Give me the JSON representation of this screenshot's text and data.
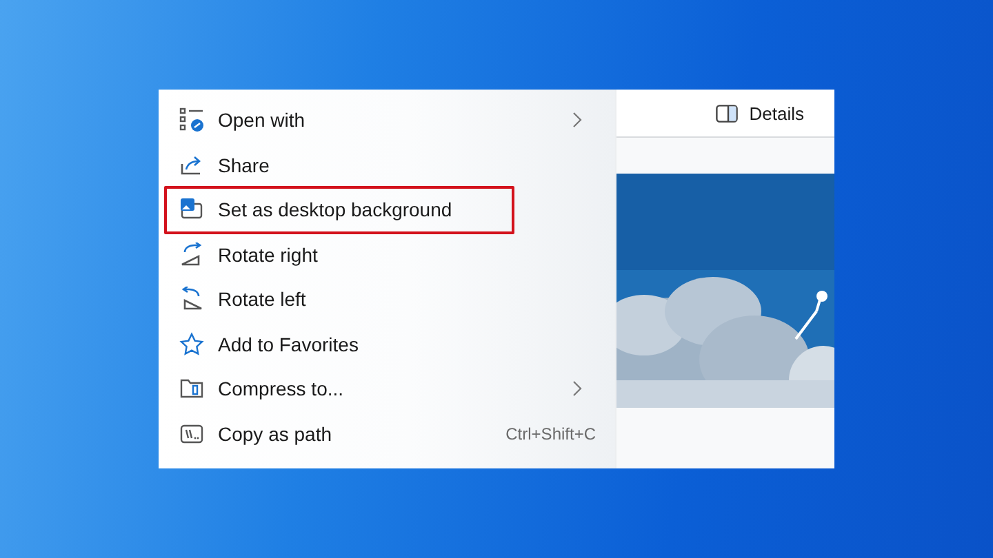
{
  "menu": {
    "items": [
      {
        "label": "Open with",
        "submenu": true,
        "highlighted": false
      },
      {
        "label": "Share",
        "submenu": false,
        "highlighted": false
      },
      {
        "label": "Set as desktop background",
        "submenu": false,
        "highlighted": true
      },
      {
        "label": "Rotate right",
        "submenu": false,
        "highlighted": false
      },
      {
        "label": "Rotate left",
        "submenu": false,
        "highlighted": false
      },
      {
        "label": "Add to Favorites",
        "submenu": false,
        "highlighted": false
      },
      {
        "label": "Compress to...",
        "submenu": true,
        "highlighted": false
      },
      {
        "label": "Copy as path",
        "submenu": false,
        "highlighted": false,
        "shortcut": "Ctrl+Shift+C"
      }
    ]
  },
  "toolbar": {
    "details_button": {
      "label": "Details"
    }
  }
}
